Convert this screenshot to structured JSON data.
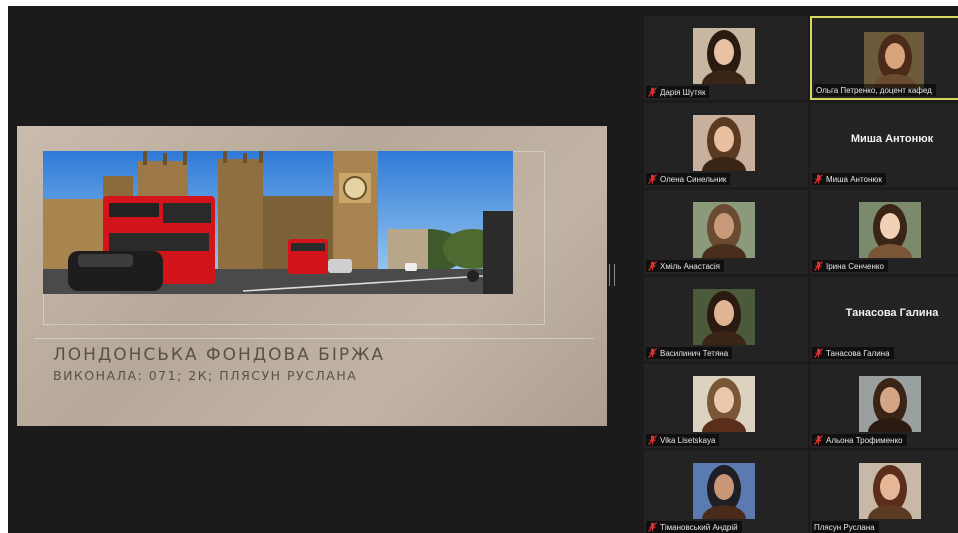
{
  "slide": {
    "title": "ЛОНДОНСЬКА ФОНДОВА БІРЖА",
    "subtitle": "ВИКОНАЛА: 071; 2К; ПЛЯСУН РУСЛАНА"
  },
  "participants": [
    {
      "name": "Дарія Шутяк",
      "video": true,
      "muted": true
    },
    {
      "name": "Ольга Петренко, доцент кафед",
      "video": true,
      "muted": false,
      "active_speaker": true
    },
    {
      "name": "Олена Синельник",
      "video": true,
      "muted": true
    },
    {
      "name": "Миша Антонюк",
      "video": false,
      "muted": true
    },
    {
      "name": "Хміль Анастасія",
      "video": true,
      "muted": true
    },
    {
      "name": "Ірина Сенченко",
      "video": true,
      "muted": true
    },
    {
      "name": "Василинич Тетяна",
      "video": true,
      "muted": true
    },
    {
      "name": "Танасова Галина",
      "video": false,
      "muted": true
    },
    {
      "name": "Vika Lisetskaya",
      "video": true,
      "muted": true
    },
    {
      "name": "Альона Трофименко",
      "video": true,
      "muted": true
    },
    {
      "name": "Тімановський Андрій",
      "video": true,
      "muted": true
    },
    {
      "name": "Плясун Руслана",
      "video": true,
      "muted": false
    }
  ],
  "colors": {
    "active_speaker_border": "#d7d860",
    "mute_icon": "#e0322f",
    "background": "#1b1b1b",
    "tile": "#232323"
  },
  "icons": {
    "mute": "muted-microphone-icon"
  }
}
